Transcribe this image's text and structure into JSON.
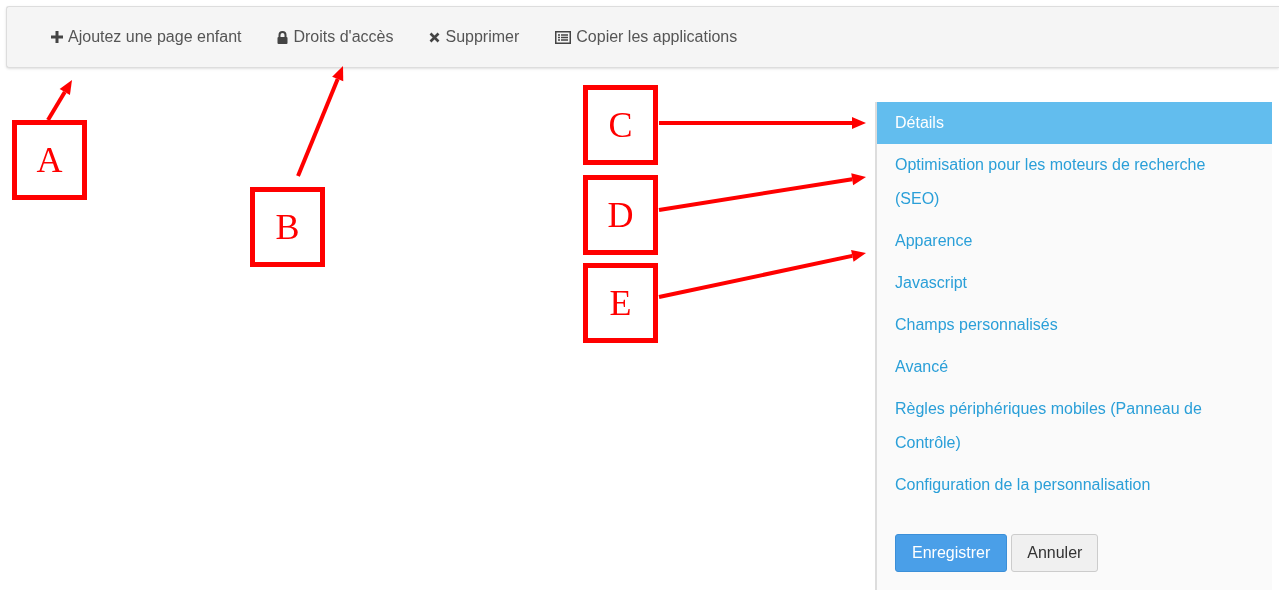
{
  "toolbar": {
    "items": [
      {
        "label": "Ajoutez une page enfant"
      },
      {
        "label": "Droits d'accès"
      },
      {
        "label": "Supprimer"
      },
      {
        "label": "Copier les applications"
      }
    ]
  },
  "side_menu": {
    "items": [
      {
        "label": "Détails",
        "selected": true
      },
      {
        "label": "Optimisation pour les moteurs de recherche (SEO)",
        "selected": false
      },
      {
        "label": "Apparence",
        "selected": false
      },
      {
        "label": "Javascript",
        "selected": false
      },
      {
        "label": "Champs personnalisés",
        "selected": false
      },
      {
        "label": "Avancé",
        "selected": false
      },
      {
        "label": "Règles périphériques mobiles (Panneau de Contrôle)",
        "selected": false
      },
      {
        "label": "Configuration de la personnalisation",
        "selected": false
      }
    ],
    "buttons": [
      {
        "label": "Enregistrer",
        "kind": "primary"
      },
      {
        "label": "Annuler",
        "kind": "default"
      }
    ]
  },
  "annotations": [
    {
      "label": "A"
    },
    {
      "label": "B"
    },
    {
      "label": "C"
    },
    {
      "label": "D"
    },
    {
      "label": "E"
    }
  ]
}
